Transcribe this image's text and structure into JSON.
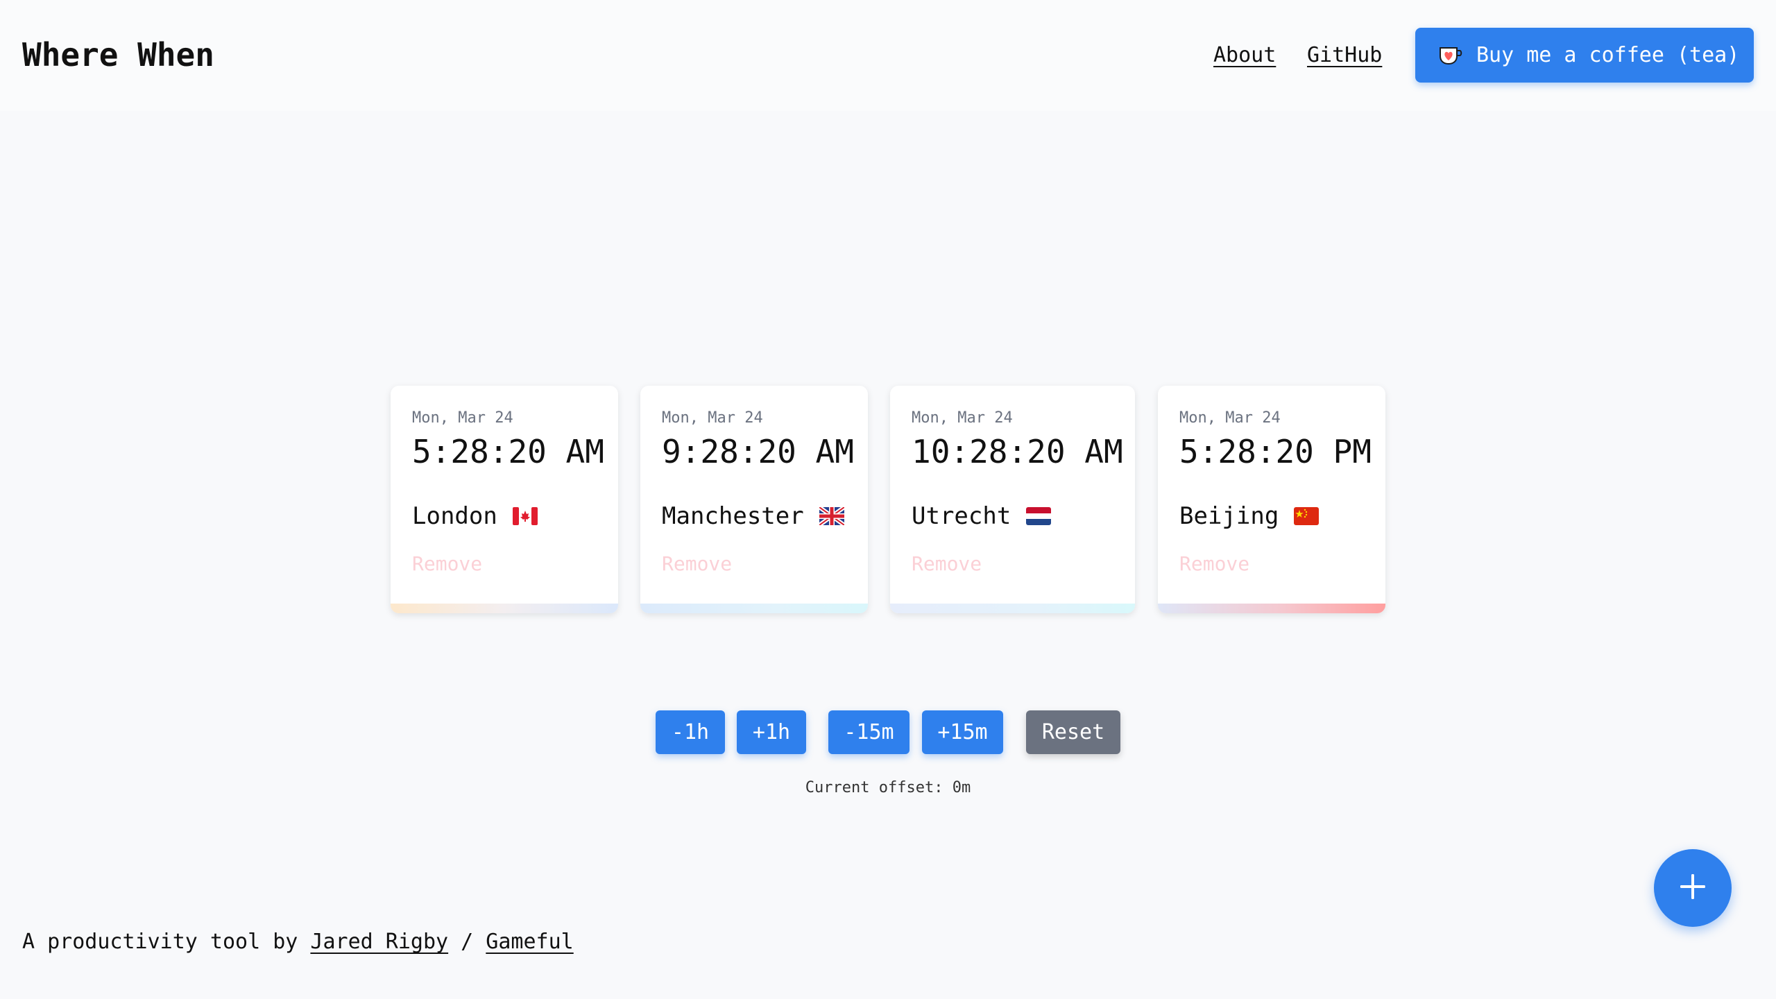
{
  "header": {
    "brand": "Where When",
    "nav": {
      "about": "About",
      "github": "GitHub"
    },
    "coffee_button": {
      "label": "Buy me a coffee (tea)",
      "icon": "coffee-cup-heart-icon"
    }
  },
  "cards": [
    {
      "date": "Mon, Mar 24",
      "time": "5:28:20 AM",
      "city": "London",
      "flag": "canada-flag-icon",
      "remove_label": "Remove"
    },
    {
      "date": "Mon, Mar 24",
      "time": "9:28:20 AM",
      "city": "Manchester",
      "flag": "uk-flag-icon",
      "remove_label": "Remove"
    },
    {
      "date": "Mon, Mar 24",
      "time": "10:28:20 AM",
      "city": "Utrecht",
      "flag": "netherlands-flag-icon",
      "remove_label": "Remove"
    },
    {
      "date": "Mon, Mar 24",
      "time": "5:28:20 PM",
      "city": "Beijing",
      "flag": "china-flag-icon",
      "remove_label": "Remove"
    }
  ],
  "controls": {
    "minus_1h": "-1h",
    "plus_1h": "+1h",
    "minus_15m": "-15m",
    "plus_15m": "+15m",
    "reset": "Reset",
    "offset_label": "Current offset: 0m"
  },
  "fab": {
    "icon": "plus-icon"
  },
  "footer": {
    "prefix": "A productivity tool by ",
    "author": "Jared Rigby",
    "separator": " / ",
    "company": "Gameful"
  },
  "colors": {
    "accent": "#2f80ed",
    "reset": "#6b7280",
    "remove": "#fbd0d6",
    "background": "#f8f9fb"
  }
}
